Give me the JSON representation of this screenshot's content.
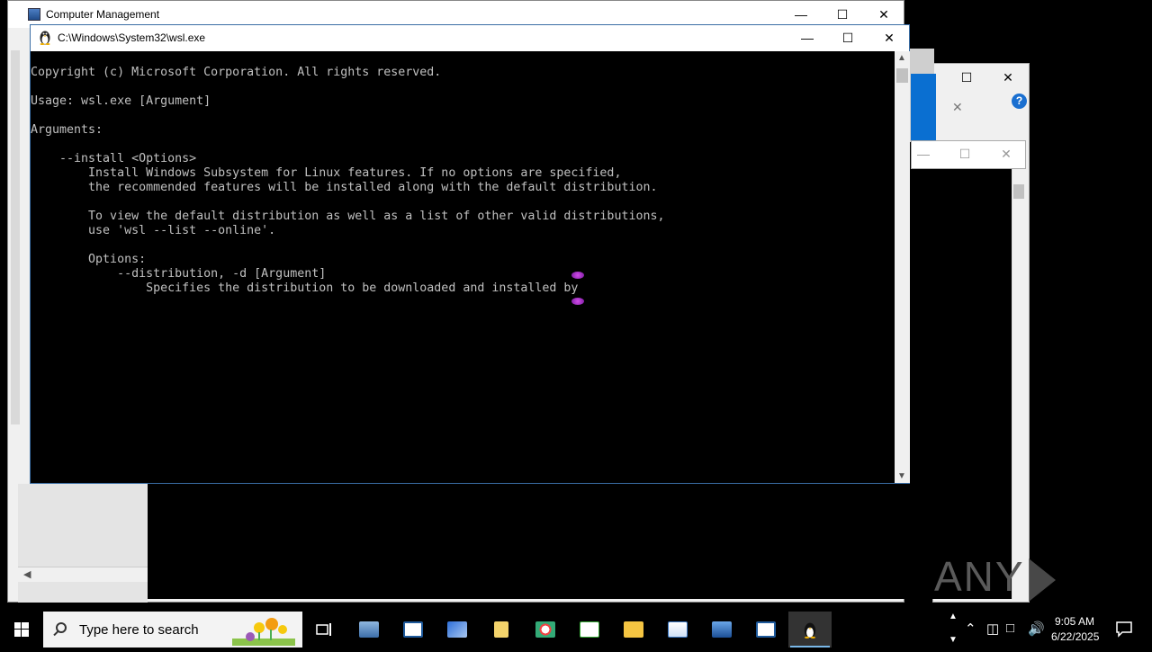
{
  "background_window": {
    "title": "Computer Management"
  },
  "console_window": {
    "title": "C:\\Windows\\System32\\wsl.exe",
    "lines": [
      "Copyright (c) Microsoft Corporation. All rights reserved.",
      "",
      "Usage: wsl.exe [Argument]",
      "",
      "Arguments:",
      "",
      "    --install <Options>",
      "        Install Windows Subsystem for Linux features. If no options are specified,",
      "        the recommended features will be installed along with the default distribution.",
      "",
      "        To view the default distribution as well as a list of other valid distributions,",
      "        use 'wsl --list --online'.",
      "",
      "        Options:",
      "            --distribution, -d [Argument]",
      "                Specifies the distribution to be downloaded and installed by"
    ]
  },
  "watermark": {
    "left": "ANY",
    "right": "RUN"
  },
  "taskbar": {
    "search_placeholder": "Type here to search",
    "apps": [
      "task-view",
      "computer-management",
      "event-viewer",
      "registry-tool",
      "explorer-search",
      "paint",
      "notepad-chart",
      "file-explorer",
      "wordpad",
      "network-manager",
      "console-window",
      "wsl-linux"
    ],
    "clock_time": "9:05 AM",
    "clock_date": "6/22/2025"
  }
}
